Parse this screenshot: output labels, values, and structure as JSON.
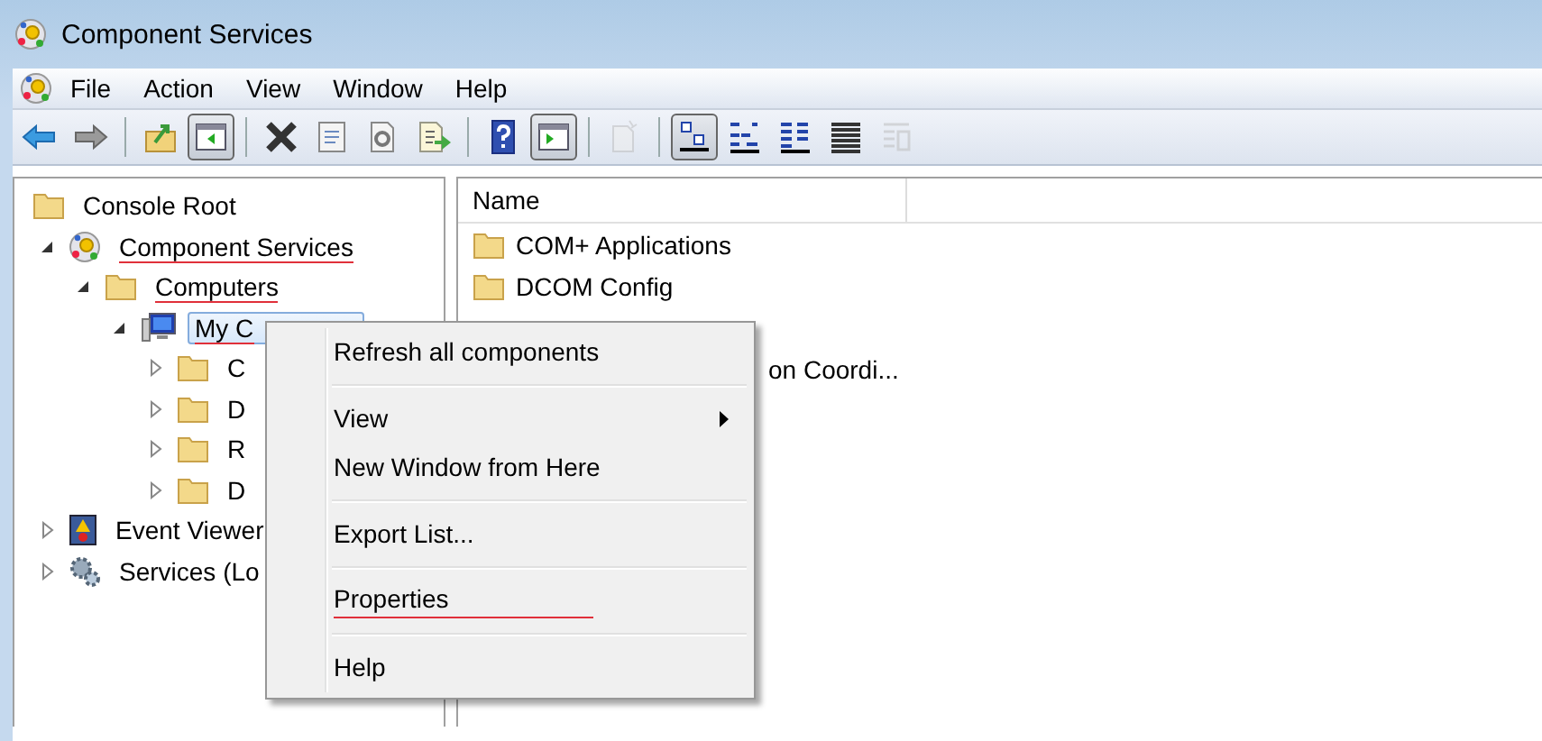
{
  "window": {
    "title": "Component Services"
  },
  "menu_bar": [
    "File",
    "Action",
    "View",
    "Window",
    "Help"
  ],
  "toolbar": [
    {
      "kind": "back",
      "pressed": false,
      "disabled": false
    },
    {
      "kind": "forward",
      "pressed": false,
      "disabled": false
    },
    {
      "kind": "sep"
    },
    {
      "kind": "up",
      "pressed": false,
      "disabled": false
    },
    {
      "kind": "tree",
      "pressed": true,
      "disabled": false
    },
    {
      "kind": "sep"
    },
    {
      "kind": "delete",
      "pressed": false,
      "disabled": false
    },
    {
      "kind": "props",
      "pressed": false,
      "disabled": false
    },
    {
      "kind": "refresh",
      "pressed": false,
      "disabled": false
    },
    {
      "kind": "export",
      "pressed": false,
      "disabled": false
    },
    {
      "kind": "sep"
    },
    {
      "kind": "help",
      "pressed": false,
      "disabled": false
    },
    {
      "kind": "action",
      "pressed": true,
      "disabled": false
    },
    {
      "kind": "sep"
    },
    {
      "kind": "new",
      "pressed": false,
      "disabled": true
    },
    {
      "kind": "sep"
    },
    {
      "kind": "large",
      "pressed": true,
      "disabled": false
    },
    {
      "kind": "small",
      "pressed": false,
      "disabled": false
    },
    {
      "kind": "list",
      "pressed": false,
      "disabled": false
    },
    {
      "kind": "detail",
      "pressed": false,
      "disabled": false
    },
    {
      "kind": "custom",
      "pressed": false,
      "disabled": true
    }
  ],
  "tree": [
    {
      "label": "Console Root",
      "kind": "folder",
      "underlined": false,
      "selected": false,
      "children": [
        {
          "label": "Component Services",
          "kind": "com",
          "expanded": true,
          "underlined": true,
          "selected": false,
          "children": [
            {
              "label": "Computers",
              "kind": "folder",
              "expanded": true,
              "underlined": true,
              "selected": false,
              "children": [
                {
                  "label": "My C",
                  "kind": "computer",
                  "expanded": true,
                  "underlined": true,
                  "selected": true,
                  "children": [
                    {
                      "label": "C",
                      "kind": "folder",
                      "expanded": false,
                      "underlined": false,
                      "selected": false
                    },
                    {
                      "label": "D",
                      "kind": "folder",
                      "expanded": false,
                      "underlined": false,
                      "selected": false
                    },
                    {
                      "label": "R",
                      "kind": "folder",
                      "expanded": false,
                      "underlined": false,
                      "selected": false
                    },
                    {
                      "label": "D",
                      "kind": "folder",
                      "expanded": false,
                      "underlined": false,
                      "selected": false
                    }
                  ]
                }
              ]
            }
          ]
        },
        {
          "label": "Event Viewer",
          "kind": "log",
          "expanded": false,
          "underlined": false,
          "selected": false
        },
        {
          "label": "Services (Lo",
          "kind": "gear",
          "expanded": false,
          "underlined": false,
          "selected": false
        }
      ]
    }
  ],
  "list": {
    "columns": [
      "Name"
    ],
    "rows": [
      {
        "kind": "item",
        "label": "COM+ Applications"
      },
      {
        "kind": "item",
        "label": "DCOM Config"
      },
      {
        "kind": "hidden"
      },
      {
        "kind": "partial",
        "label": "on Coordi..."
      }
    ]
  },
  "context_menu": [
    {
      "kind": "item",
      "label": "Refresh all components",
      "submenu": false,
      "underlined": false
    },
    {
      "kind": "sep"
    },
    {
      "kind": "item",
      "label": "View",
      "submenu": true,
      "underlined": false
    },
    {
      "kind": "item",
      "label": "New Window from Here",
      "submenu": false,
      "underlined": false
    },
    {
      "kind": "sep"
    },
    {
      "kind": "item",
      "label": "Export List...",
      "submenu": false,
      "underlined": false
    },
    {
      "kind": "sep"
    },
    {
      "kind": "item",
      "label": "Properties",
      "submenu": false,
      "underlined": true
    },
    {
      "kind": "sep"
    },
    {
      "kind": "item",
      "label": "Help",
      "submenu": false,
      "underlined": false
    }
  ]
}
